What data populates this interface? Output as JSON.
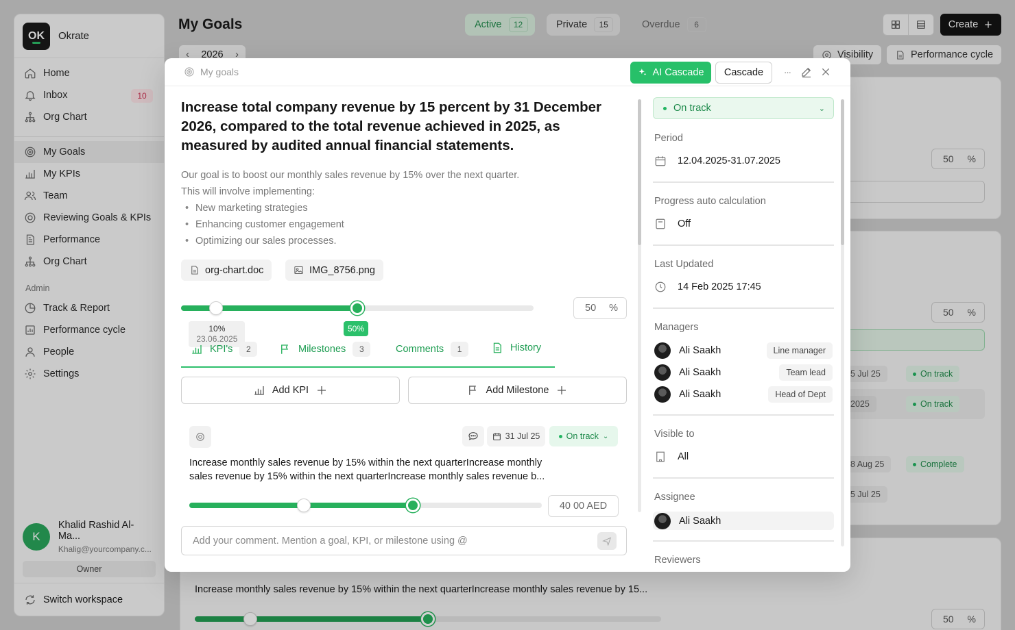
{
  "app": {
    "logo_text": "OK",
    "name": "Okrate"
  },
  "sidebar": {
    "items": [
      {
        "label": "Home",
        "icon": "home-icon"
      },
      {
        "label": "Inbox",
        "icon": "bell-icon",
        "badge": "10"
      },
      {
        "label": "Org Chart",
        "icon": "org-chart-icon"
      }
    ],
    "items2": [
      {
        "label": "My Goals",
        "icon": "target-icon"
      },
      {
        "label": "My KPIs",
        "icon": "bar-chart-icon"
      },
      {
        "label": "Team",
        "icon": "team-icon"
      },
      {
        "label": "Reviewing Goals & KPIs",
        "icon": "target-icon"
      },
      {
        "label": "Performance",
        "icon": "document-icon"
      },
      {
        "label": "Org Chart",
        "icon": "org-chart-icon"
      }
    ],
    "admin_label": "Admin",
    "admin_items": [
      {
        "label": "Track & Report",
        "icon": "pie-chart-icon"
      },
      {
        "label": "Performance cycle",
        "icon": "report-icon"
      },
      {
        "label": "People",
        "icon": "person-icon"
      },
      {
        "label": "Settings",
        "icon": "gear-icon"
      }
    ],
    "user": {
      "initial": "K",
      "name": "Khalid Rashid Al-Ma...",
      "email": "Khalig@yourcompany.c...",
      "role": "Owner"
    },
    "switch_label": "Switch workspace"
  },
  "header": {
    "title": "My Goals",
    "tabs": [
      {
        "label": "Active",
        "count": "12"
      },
      {
        "label": "Private",
        "count": "15"
      },
      {
        "label": "Overdue",
        "count": "6"
      }
    ],
    "create_label": "Create",
    "year": "2026",
    "visibility_label": "Visibility",
    "cycle_label": "Performance cycle"
  },
  "background": {
    "pct_1": "50",
    "pct_2": "50",
    "pct_3": "50",
    "dates": [
      "5 Jul 25",
      "2025",
      "8 Aug 25",
      "5 Jul 25"
    ],
    "statuses": [
      "On track",
      "On track",
      "Complete"
    ],
    "kpi_text": "Increase monthly sales revenue by 15% within the next quarterIncrease monthly sales revenue by 15...",
    "bottom_progress": 0.5
  },
  "modal": {
    "breadcrumb": "My goals",
    "ai_cascade_label": "AI Cascade",
    "cascade_label": "Cascade",
    "more_label": "···",
    "title": "Increase total company revenue by 15 percent by 31 December 2026, compared to the total revenue achieved in 2025, as measured by audited annual financial statements.",
    "desc_intro": "Our goal is to boost our monthly sales revenue by 15% over the next quarter.",
    "desc_line2": "This will involve implementing:",
    "desc_items": [
      "New marketing strategies",
      "Enhancing customer engagement",
      "Optimizing our sales processes."
    ],
    "attachments": [
      "org-chart.doc",
      "IMG_8756.png"
    ],
    "progress": {
      "prev_value": 0.1,
      "value": 0.5,
      "prev_label": "10%",
      "prev_date": "23.06.2025",
      "current_label": "50%",
      "input": "50",
      "unit": "%"
    },
    "tabs": [
      {
        "label": "KPI's",
        "count": "2",
        "icon": "bar-chart-icon"
      },
      {
        "label": "Milestones",
        "count": "3",
        "icon": "flag-icon"
      },
      {
        "label": "Comments",
        "count": "1"
      },
      {
        "label": "History",
        "icon": "document-icon"
      }
    ],
    "add_kpi_label": "Add KPI",
    "add_milestone_label": "Add Milestone",
    "kpi": {
      "date": "31 Jul 25",
      "status": "On track",
      "text": "Increase monthly sales revenue by 15% within the next quarterIncrease monthly sales revenue by 15% within the next quarterIncrease monthly sales revenue b...",
      "prev_value": 0.325,
      "value": 0.635,
      "value_text": "40 00 AED"
    },
    "comment_placeholder": "Add your comment. Mention a goal, KPI, or milestone using @",
    "right": {
      "status": "On track",
      "period_label": "Period",
      "period": "12.04.2025-31.07.2025",
      "auto_label": "Progress auto calculation",
      "auto": "Off",
      "updated_label": "Last Updated",
      "updated": "14 Feb 2025 17:45",
      "managers_label": "Managers",
      "managers": [
        {
          "name": "Ali Saakh",
          "role": "Line manager"
        },
        {
          "name": "Ali Saakh",
          "role": "Team lead"
        },
        {
          "name": "Ali Saakh",
          "role": "Head of Dept"
        }
      ],
      "visible_label": "Visible to",
      "visible": "All",
      "assignee_label": "Assignee",
      "assignee": "Ali Saakh",
      "reviewers_label": "Reviewers"
    }
  },
  "colors": {
    "accent": "#27b05c",
    "ai_button": "#27c069",
    "badge_red": "#d03355"
  }
}
